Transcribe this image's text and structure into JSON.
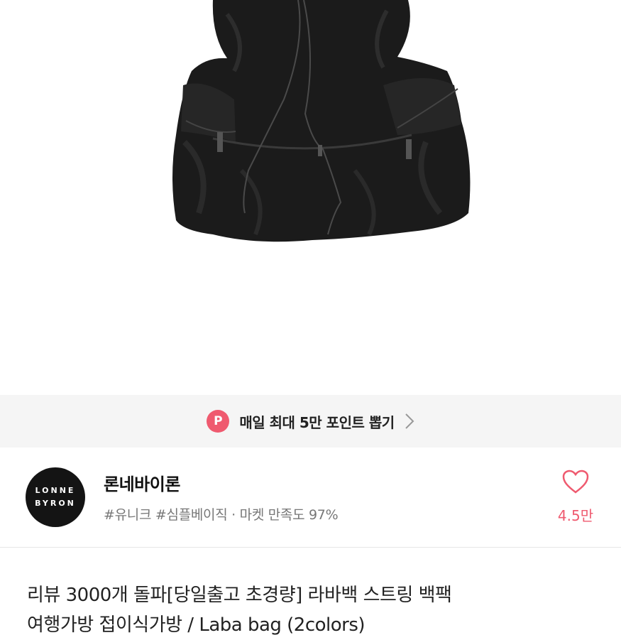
{
  "product_image": {
    "icon": "drawstring-backpack-photo"
  },
  "promo_banner": {
    "badge": "P",
    "text": "매일 최대 5만 포인트 뽑기",
    "badge_color": "#ef5a6f"
  },
  "store": {
    "logo_line1": "LONNE",
    "logo_line2": "BYRON",
    "name": "론네바이론",
    "meta": "#유니크 #심플베이직 · 마켓 만족도 97%",
    "likes": "4.5만",
    "accent_color": "#ef5a6f"
  },
  "product": {
    "title_line1": "리뷰 3000개 돌파[당일출고 초경량] 라바백 스트링 백팩",
    "title_line2": "여행가방 접이식가방 / Laba bag (2colors)"
  }
}
